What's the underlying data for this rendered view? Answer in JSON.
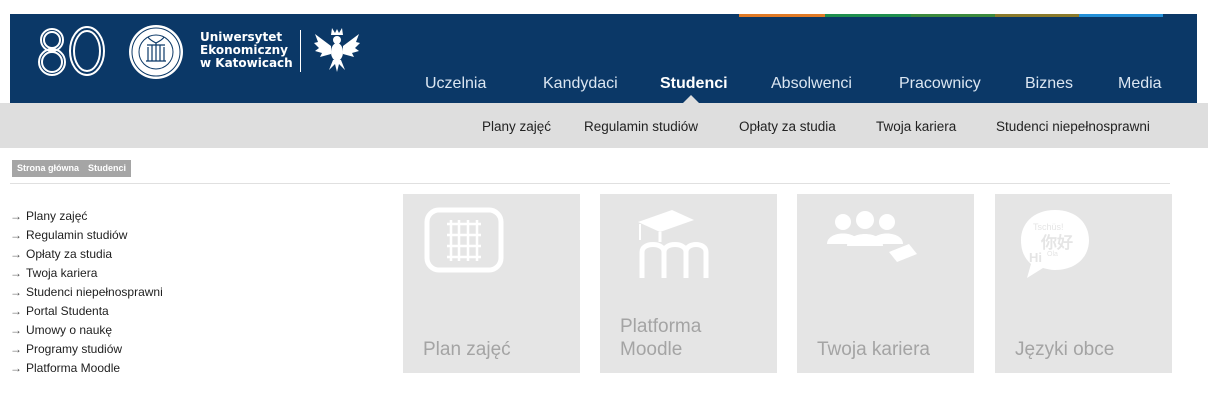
{
  "branding": {
    "anniversary": "80",
    "university_name": [
      "Uniwersytet",
      "Ekonomiczny",
      "w Katowicach"
    ]
  },
  "colors": {
    "header_bg": "#0b3867",
    "subnav_bg": "#dedede",
    "tile_bg": "#e5e5e5",
    "tile_text": "#a4a4a4",
    "stripe": [
      "#e07a26",
      "#1f8f4e",
      "#3c8a3d",
      "#8a7a2b",
      "#1f7fb8",
      "#2390d8"
    ]
  },
  "main_nav": {
    "items": [
      {
        "label": "Uczelnia"
      },
      {
        "label": "Kandydaci"
      },
      {
        "label": "Studenci"
      },
      {
        "label": "Absolwenci"
      },
      {
        "label": "Pracownicy"
      },
      {
        "label": "Biznes"
      },
      {
        "label": "Media"
      }
    ],
    "active": "Studenci"
  },
  "sub_nav": {
    "items": [
      {
        "label": "Plany zajęć"
      },
      {
        "label": "Regulamin studiów"
      },
      {
        "label": "Opłaty za studia"
      },
      {
        "label": "Twoja kariera"
      },
      {
        "label": "Studenci niepełnosprawni"
      }
    ]
  },
  "breadcrumb": {
    "items": [
      {
        "label": "Strona główna"
      },
      {
        "label": "Studenci"
      }
    ]
  },
  "sidebar": {
    "arrow": "→",
    "items": [
      {
        "label": "Plany zajęć"
      },
      {
        "label": "Regulamin studiów"
      },
      {
        "label": "Opłaty za studia"
      },
      {
        "label": "Twoja kariera"
      },
      {
        "label": "Studenci niepełnosprawni"
      },
      {
        "label": "Portal Studenta"
      },
      {
        "label": "Umowy o naukę"
      },
      {
        "label": "Programy studiów"
      },
      {
        "label": "Platforma Moodle"
      }
    ]
  },
  "tiles": [
    {
      "label": "Plan zajęć",
      "icon": "calendar-grid-icon"
    },
    {
      "label": "Platforma Moodle",
      "icon": "moodle-icon"
    },
    {
      "label": "Twoja kariera",
      "icon": "people-icon"
    },
    {
      "label": "Języki obce",
      "icon": "languages-speech-icon",
      "icon_text": {
        "top": "Tschüs!",
        "middle": "你好",
        "bottom": "Hi",
        "small": "Ola"
      }
    }
  ]
}
